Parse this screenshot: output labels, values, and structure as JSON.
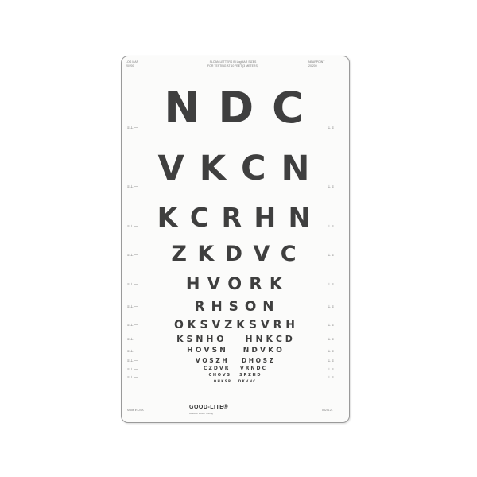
{
  "header": {
    "left_lines": [
      "LOG MAR",
      "20/200"
    ],
    "center_lines": [
      "SLOAN LETTERS IN LogMAR SIZES",
      "FOR TESTING AT 10 FEET (3 METERS)"
    ],
    "right_lines": [
      "NEARPOINT",
      "20/200"
    ]
  },
  "rows": [
    "N D C",
    "V K C N",
    "K C R H N",
    "Z K D V C",
    "H V O R K",
    "R H S O N",
    "O K S V Z K S V R H",
    "K S N H O       H N K C D",
    "H O V S N       N D V K O",
    "V O S Z H       D H O S Z",
    "C Z D V R       V R N D C",
    "C H O V S       S R Z H D",
    "O H K S R       D K V N C"
  ],
  "footer": {
    "logo": "GOOD-LITE®",
    "tagline": "Reliable Vision Testing",
    "left": "Made in USA",
    "right": "#32512L"
  }
}
